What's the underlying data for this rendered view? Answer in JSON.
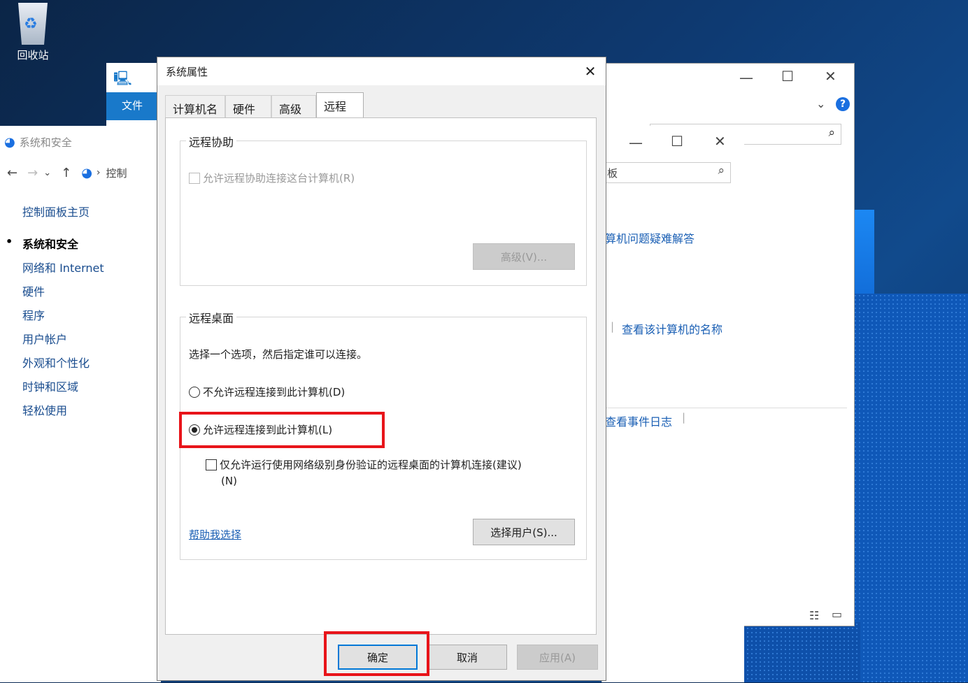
{
  "desktop": {
    "recycle_bin": "回收站"
  },
  "explorer": {
    "file_tab": "文件"
  },
  "control_panel": {
    "window_title": "系统和安全",
    "breadcrumb": "控制",
    "nav": [
      {
        "label": "控制面板主页"
      },
      {
        "label": "系统和安全"
      },
      {
        "label": "网络和 Internet"
      },
      {
        "label": "硬件"
      },
      {
        "label": "程序"
      },
      {
        "label": "用户帐户"
      },
      {
        "label": "外观和个性化"
      },
      {
        "label": "时钟和区域"
      },
      {
        "label": "轻松使用"
      }
    ]
  },
  "back_window": {
    "search_partial": "板",
    "link_troubleshoot": "算机问题疑难解答",
    "link_computer_name": "查看该计算机的名称",
    "link_event_log": "查看事件日志"
  },
  "dialog": {
    "title": "系统属性",
    "tabs": [
      "计算机名",
      "硬件",
      "高级",
      "远程"
    ],
    "remote_assist": {
      "group_label": "远程协助",
      "allow_label": "允许远程协助连接这台计算机(R)",
      "advanced_button": "高级(V)..."
    },
    "remote_desktop": {
      "group_label": "远程桌面",
      "description": "选择一个选项，然后指定谁可以连接。",
      "option_deny": "不允许远程连接到此计算机(D)",
      "option_allow": "允许远程连接到此计算机(L)",
      "nla_label_line1": "仅允许运行使用网络级别身份验证的远程桌面的计算机连接(建议)",
      "nla_label_line2": "(N)",
      "help_link": "帮助我选择",
      "select_users_button": "选择用户(S)..."
    },
    "buttons": {
      "ok": "确定",
      "cancel": "取消",
      "apply": "应用(A)"
    }
  },
  "colors": {
    "highlight": "#e8141a",
    "link": "#1a5fb4",
    "ribbon": "#1979ca"
  }
}
